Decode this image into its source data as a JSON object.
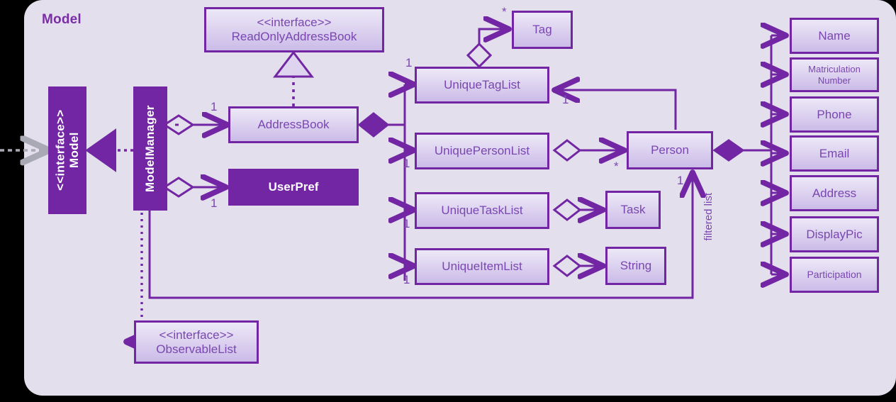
{
  "panel": {
    "title": "Model",
    "background_color": "#e4dfec",
    "outer_background_color": "#000000"
  },
  "theme": {
    "stroke": "#7226a3",
    "fill_light_top": "#ece8f7",
    "fill_light_bottom": "#cbbbe8",
    "fill_solid": "#7226a3",
    "text_on_light": "#7a46b0",
    "text_on_solid": "#ffffff",
    "external_arrow": "#a9a9b5"
  },
  "nodes": {
    "model_interface": {
      "label": "<<interface>>\nModel",
      "style": "filled-vertical"
    },
    "model_manager": {
      "label": "ModelManager",
      "style": "filled-vertical"
    },
    "read_only_address_book": {
      "label": "<<interface>>\nReadOnlyAddressBook",
      "style": "light"
    },
    "address_book": {
      "label": "AddressBook",
      "style": "light"
    },
    "user_pref": {
      "label": "UserPref",
      "style": "filled"
    },
    "observable_list": {
      "label": "<<interface>>\nObservableList",
      "style": "light"
    },
    "unique_tag_list": {
      "label": "UniqueTagList",
      "style": "light"
    },
    "unique_person_list": {
      "label": "UniquePersonList",
      "style": "light"
    },
    "unique_task_list": {
      "label": "UniqueTaskList",
      "style": "light"
    },
    "unique_item_list": {
      "label": "UniqueItemList",
      "style": "light"
    },
    "tag": {
      "label": "Tag",
      "style": "light"
    },
    "person": {
      "label": "Person",
      "style": "light"
    },
    "task": {
      "label": "Task",
      "style": "light"
    },
    "string": {
      "label": "String",
      "style": "light"
    }
  },
  "attributes": [
    {
      "label": "Name",
      "size": "normal"
    },
    {
      "label": "Matriculation\nNumber",
      "size": "small"
    },
    {
      "label": "Phone",
      "size": "normal"
    },
    {
      "label": "Email",
      "size": "normal"
    },
    {
      "label": "Address",
      "size": "normal"
    },
    {
      "label": "DisplayPic",
      "size": "normal"
    },
    {
      "label": "Participation",
      "size": "smallish"
    }
  ],
  "multiplicities": {
    "model_manager_to_address_book": "1",
    "model_manager_to_user_pref": "1",
    "address_book_to_unique_tag_list": "1",
    "address_book_to_unique_person_list": "1",
    "address_book_to_unique_task_list": "1",
    "address_book_to_unique_item_list": "1",
    "unique_tag_list_to_tag": "*",
    "person_to_unique_tag_list": "1",
    "unique_person_list_to_person": "*",
    "model_manager_to_person": "1"
  },
  "edge_labels": {
    "filtered_list": "filtered list"
  }
}
